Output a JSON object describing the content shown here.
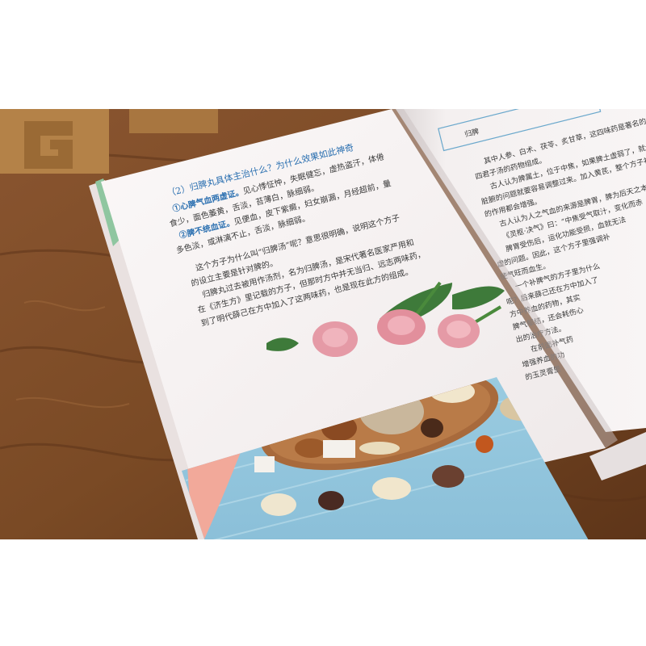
{
  "left_page": {
    "heading": "（2）归脾丸具体主治什么？为什么效果如此神奇",
    "item1_title": "①心脾气血两虚证。",
    "item1_rest": "见心悸怔忡，失眠健忘，虚热盗汗，体倦",
    "item1_cont1": "食少，面色萎黄，舌淡，苔薄白，脉细弱。",
    "item2_title": "②脾不统血证。",
    "item2_rest": "见便血，皮下紫癜，妇女崩漏，月经超前，量",
    "item2_cont1": "多色淡，或淋漓不止，舌淡，脉细弱。",
    "para1": "这个方子为什么叫“归脾汤”呢？意思很明确，说明这个方子",
    "para2": "的设立主要是针对脾的。",
    "para3": "归脾丸过去被用作汤剂，名为归脾汤，是宋代著名医家严用和",
    "para4": "在《济生方》里记载的方子，但那时方中并无当归、远志两味药，",
    "para5": "到了明代薛己在方中加入了这两味药，也是现在此方的组成。"
  },
  "right_page": {
    "box_text": "归脾",
    "lines": [
      "其中人参、白术、茯苓、炙甘草，这四味药是著名的补气的",
      "四君子汤的药物组成。",
      "古人认为脾属土，位于中焦，如果脾土虚弱了，就会导致",
      "脏腑的问题就要容易调整过来。加入黄芪，整个方子补",
      "的作用都会增强。",
      "古人认为人之气血的来源是脾胃，脾为后天之本",
      "《灵枢·决气》曰：“中焦受气取汁，变化而赤",
      "脾胃受伤后，运化功能受损，血就无法",
      "虚的问题。因此，这个方子里强调补",
      "使气旺而血生。",
      "一个补脾气的方子里为什么",
      "呢？后来薛己还在方中加入了",
      "方中养血的药物，其实",
      "脾气郁结，还会耗伤心",
      "出的治疗方法。",
      "在前面补气药",
      "增强养血的功",
      "的玉灵膏里"
    ]
  },
  "colors": {
    "table_wood": "#7a4a25",
    "page": "#f6f2f0",
    "heading_blue": "#2a6fb0",
    "text_dark": "#3a3a3a",
    "photo_board": "#8ec3dc",
    "towel_pink": "#f2a99a",
    "rose": "#e59aa6"
  }
}
